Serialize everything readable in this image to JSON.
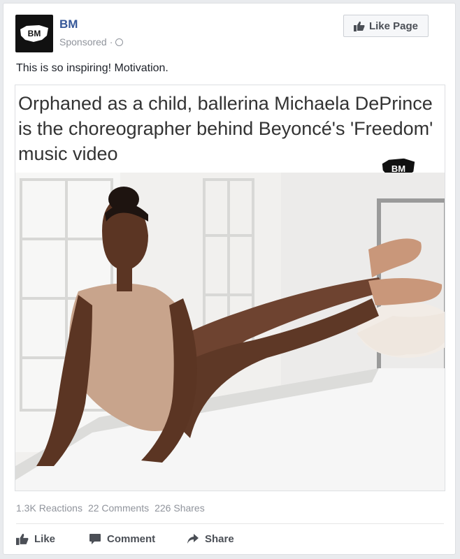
{
  "post": {
    "page_name": "BM",
    "sponsored_label": "Sponsored",
    "separator": "·",
    "avatar_text": "BM",
    "like_page_label": "Like Page",
    "caption": "This is so inspiring! Motivation."
  },
  "media": {
    "headline": "Orphaned as a child, ballerina Michaela DePrince is the choreographer behind Beyoncé's 'Freedom' music video",
    "watermark_text": "BM"
  },
  "stats": {
    "reactions": "1.3K Reactions",
    "comments": "22 Comments",
    "shares": "226 Shares"
  },
  "actions": {
    "like": "Like",
    "comment": "Comment",
    "share": "Share"
  },
  "icons": [
    "globe-icon",
    "thumbs-up-icon",
    "comment-icon",
    "share-arrow-icon"
  ],
  "colors": {
    "page_name": "#365899",
    "meta": "#90949c",
    "text": "#1d2129",
    "action": "#4b4f56"
  }
}
